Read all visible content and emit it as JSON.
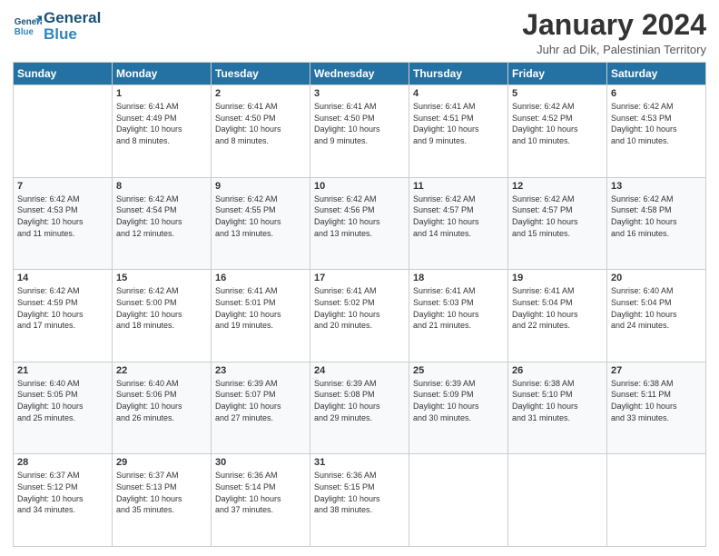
{
  "header": {
    "logo_line1": "General",
    "logo_line2": "Blue",
    "month_title": "January 2024",
    "location": "Juhr ad Dik, Palestinian Territory"
  },
  "days_of_week": [
    "Sunday",
    "Monday",
    "Tuesday",
    "Wednesday",
    "Thursday",
    "Friday",
    "Saturday"
  ],
  "weeks": [
    [
      {
        "day": "",
        "info": ""
      },
      {
        "day": "1",
        "info": "Sunrise: 6:41 AM\nSunset: 4:49 PM\nDaylight: 10 hours\nand 8 minutes."
      },
      {
        "day": "2",
        "info": "Sunrise: 6:41 AM\nSunset: 4:50 PM\nDaylight: 10 hours\nand 8 minutes."
      },
      {
        "day": "3",
        "info": "Sunrise: 6:41 AM\nSunset: 4:50 PM\nDaylight: 10 hours\nand 9 minutes."
      },
      {
        "day": "4",
        "info": "Sunrise: 6:41 AM\nSunset: 4:51 PM\nDaylight: 10 hours\nand 9 minutes."
      },
      {
        "day": "5",
        "info": "Sunrise: 6:42 AM\nSunset: 4:52 PM\nDaylight: 10 hours\nand 10 minutes."
      },
      {
        "day": "6",
        "info": "Sunrise: 6:42 AM\nSunset: 4:53 PM\nDaylight: 10 hours\nand 10 minutes."
      }
    ],
    [
      {
        "day": "7",
        "info": "Sunrise: 6:42 AM\nSunset: 4:53 PM\nDaylight: 10 hours\nand 11 minutes."
      },
      {
        "day": "8",
        "info": "Sunrise: 6:42 AM\nSunset: 4:54 PM\nDaylight: 10 hours\nand 12 minutes."
      },
      {
        "day": "9",
        "info": "Sunrise: 6:42 AM\nSunset: 4:55 PM\nDaylight: 10 hours\nand 13 minutes."
      },
      {
        "day": "10",
        "info": "Sunrise: 6:42 AM\nSunset: 4:56 PM\nDaylight: 10 hours\nand 13 minutes."
      },
      {
        "day": "11",
        "info": "Sunrise: 6:42 AM\nSunset: 4:57 PM\nDaylight: 10 hours\nand 14 minutes."
      },
      {
        "day": "12",
        "info": "Sunrise: 6:42 AM\nSunset: 4:57 PM\nDaylight: 10 hours\nand 15 minutes."
      },
      {
        "day": "13",
        "info": "Sunrise: 6:42 AM\nSunset: 4:58 PM\nDaylight: 10 hours\nand 16 minutes."
      }
    ],
    [
      {
        "day": "14",
        "info": "Sunrise: 6:42 AM\nSunset: 4:59 PM\nDaylight: 10 hours\nand 17 minutes."
      },
      {
        "day": "15",
        "info": "Sunrise: 6:42 AM\nSunset: 5:00 PM\nDaylight: 10 hours\nand 18 minutes."
      },
      {
        "day": "16",
        "info": "Sunrise: 6:41 AM\nSunset: 5:01 PM\nDaylight: 10 hours\nand 19 minutes."
      },
      {
        "day": "17",
        "info": "Sunrise: 6:41 AM\nSunset: 5:02 PM\nDaylight: 10 hours\nand 20 minutes."
      },
      {
        "day": "18",
        "info": "Sunrise: 6:41 AM\nSunset: 5:03 PM\nDaylight: 10 hours\nand 21 minutes."
      },
      {
        "day": "19",
        "info": "Sunrise: 6:41 AM\nSunset: 5:04 PM\nDaylight: 10 hours\nand 22 minutes."
      },
      {
        "day": "20",
        "info": "Sunrise: 6:40 AM\nSunset: 5:04 PM\nDaylight: 10 hours\nand 24 minutes."
      }
    ],
    [
      {
        "day": "21",
        "info": "Sunrise: 6:40 AM\nSunset: 5:05 PM\nDaylight: 10 hours\nand 25 minutes."
      },
      {
        "day": "22",
        "info": "Sunrise: 6:40 AM\nSunset: 5:06 PM\nDaylight: 10 hours\nand 26 minutes."
      },
      {
        "day": "23",
        "info": "Sunrise: 6:39 AM\nSunset: 5:07 PM\nDaylight: 10 hours\nand 27 minutes."
      },
      {
        "day": "24",
        "info": "Sunrise: 6:39 AM\nSunset: 5:08 PM\nDaylight: 10 hours\nand 29 minutes."
      },
      {
        "day": "25",
        "info": "Sunrise: 6:39 AM\nSunset: 5:09 PM\nDaylight: 10 hours\nand 30 minutes."
      },
      {
        "day": "26",
        "info": "Sunrise: 6:38 AM\nSunset: 5:10 PM\nDaylight: 10 hours\nand 31 minutes."
      },
      {
        "day": "27",
        "info": "Sunrise: 6:38 AM\nSunset: 5:11 PM\nDaylight: 10 hours\nand 33 minutes."
      }
    ],
    [
      {
        "day": "28",
        "info": "Sunrise: 6:37 AM\nSunset: 5:12 PM\nDaylight: 10 hours\nand 34 minutes."
      },
      {
        "day": "29",
        "info": "Sunrise: 6:37 AM\nSunset: 5:13 PM\nDaylight: 10 hours\nand 35 minutes."
      },
      {
        "day": "30",
        "info": "Sunrise: 6:36 AM\nSunset: 5:14 PM\nDaylight: 10 hours\nand 37 minutes."
      },
      {
        "day": "31",
        "info": "Sunrise: 6:36 AM\nSunset: 5:15 PM\nDaylight: 10 hours\nand 38 minutes."
      },
      {
        "day": "",
        "info": ""
      },
      {
        "day": "",
        "info": ""
      },
      {
        "day": "",
        "info": ""
      }
    ]
  ]
}
